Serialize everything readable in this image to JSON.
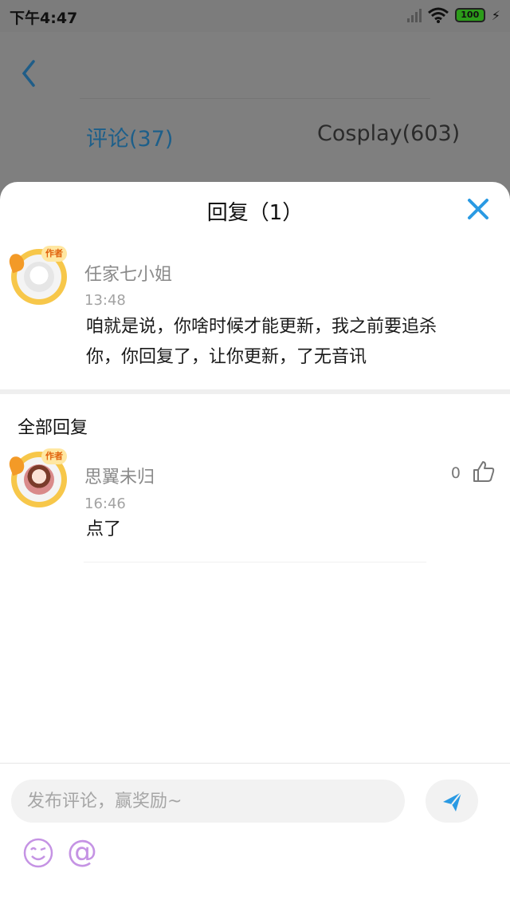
{
  "status_bar": {
    "time": "下午4:47",
    "battery": "100",
    "icons": [
      "signal-icon",
      "wifi-icon",
      "battery-icon",
      "charging-icon"
    ]
  },
  "background_page": {
    "back_icon": "chevron-left-icon",
    "tabs": [
      {
        "label": "评论(37)",
        "active": true
      },
      {
        "label": "Cosplay(603)",
        "active": false
      }
    ],
    "accent_color": "#1d5f8a"
  },
  "reply_sheet": {
    "title": "回复（1）",
    "close_icon": "close-icon",
    "close_color": "#2a9ae3",
    "original_comment": {
      "username": "任家七小姐",
      "time": "13:48",
      "text_line_1": "咱就是说，你啥时候才能更新，我之前要追杀",
      "text_line_2": "你，你回复了，让你更新，了无音讯",
      "badge": "作者"
    },
    "section_title": "全部回复",
    "replies": [
      {
        "username": "思翼未归",
        "time": "16:46",
        "text": "点了",
        "likes": "0",
        "badge": "作者"
      }
    ]
  },
  "input_bar": {
    "placeholder": "发布评论，赢奖励~",
    "send_icon": "send-icon",
    "emoji_icon": "emoji-icon",
    "at_label": "@",
    "icon_color": "#c593e4",
    "send_color": "#2a9ae3"
  }
}
